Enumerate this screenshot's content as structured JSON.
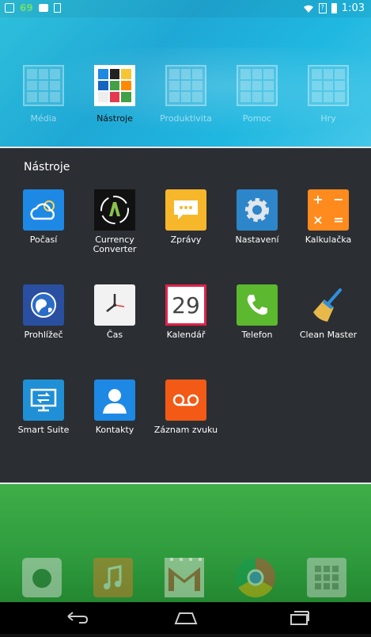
{
  "status_bar": {
    "battery_percent": "69",
    "time": "1:03",
    "icons": [
      "gallery-icon",
      "briefcase-icon",
      "sd-card-icon",
      "wifi-icon",
      "sim-unknown-icon",
      "battery-icon"
    ]
  },
  "folders": [
    {
      "label": "Média",
      "active": false
    },
    {
      "label": "Nástroje",
      "active": true
    },
    {
      "label": "Produktivita",
      "active": false
    },
    {
      "label": "Pomoc",
      "active": false
    },
    {
      "label": "Hry",
      "active": false
    }
  ],
  "panel": {
    "title": "Nástroje",
    "apps": [
      {
        "label": "Počasí",
        "icon": "weather-icon"
      },
      {
        "label": "Currency Converter",
        "icon": "currency-icon"
      },
      {
        "label": "Zprávy",
        "icon": "messages-icon"
      },
      {
        "label": "Nastavení",
        "icon": "settings-icon"
      },
      {
        "label": "Kalkulačka",
        "icon": "calculator-icon"
      },
      {
        "label": "Prohlížeč",
        "icon": "browser-icon"
      },
      {
        "label": "Čas",
        "icon": "clock-icon"
      },
      {
        "label": "Kalendář",
        "icon": "calendar-icon",
        "text": "29"
      },
      {
        "label": "Telefon",
        "icon": "phone-icon"
      },
      {
        "label": "Clean Master",
        "icon": "broom-icon"
      },
      {
        "label": "Smart Suite",
        "icon": "smart-suite-icon"
      },
      {
        "label": "Kontakty",
        "icon": "contacts-icon"
      },
      {
        "label": "Záznam zvuku",
        "icon": "voice-recorder-icon"
      }
    ]
  },
  "dock": {
    "apps": [
      "camera-icon",
      "music-icon",
      "gmail-icon",
      "chrome-icon",
      "app-drawer-icon"
    ]
  },
  "colors": {
    "panel_bg": "#2b2e33",
    "wallpaper_top": "#1fa8d5",
    "wallpaper_bottom": "#2e9a3d"
  }
}
